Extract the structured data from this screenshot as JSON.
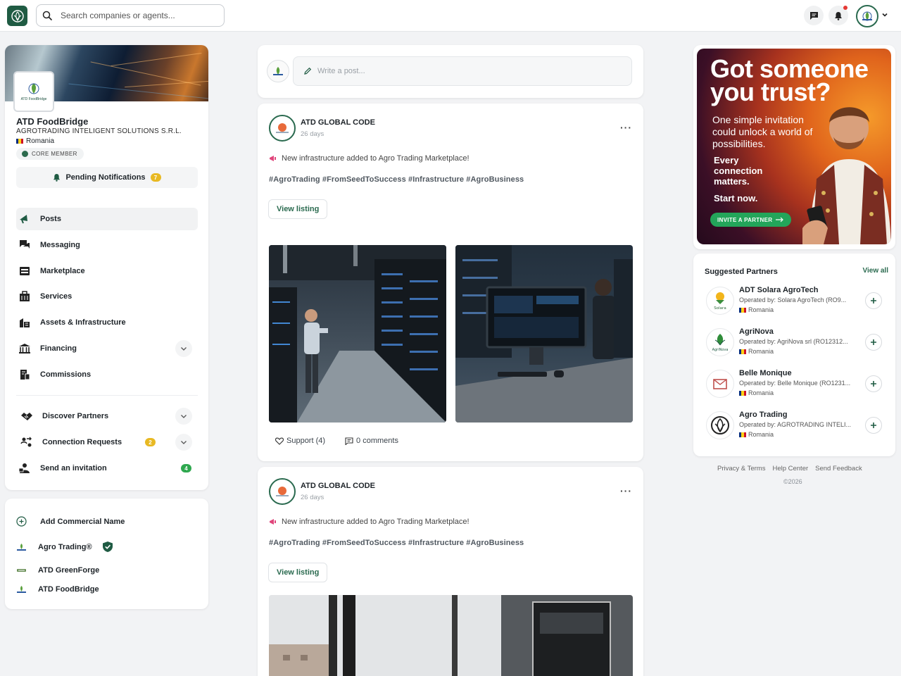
{
  "search": {
    "placeholder": "Search companies or agents..."
  },
  "profile": {
    "name": "ATD FoodBridge",
    "company": "AGROTRADING INTELIGENT SOLUTIONS S.R.L.",
    "country": "Romania",
    "badge": "CORE MEMBER",
    "logo_text": "ATD FoodBridge",
    "pending_label": "Pending Notifications",
    "pending_count": "7"
  },
  "nav": {
    "posts": "Posts",
    "messaging": "Messaging",
    "marketplace": "Marketplace",
    "services": "Services",
    "assets": "Assets & Infrastructure",
    "financing": "Financing",
    "commissions": "Commissions",
    "discover": "Discover Partners",
    "requests": "Connection Requests",
    "requests_count": "2",
    "invite": "Send an invitation",
    "invite_count": "4"
  },
  "commercial": {
    "add_label": "Add Commercial Name",
    "names": [
      "Agro Trading®",
      "ATD GreenForge",
      "ATD FoodBridge"
    ]
  },
  "composer": {
    "placeholder": "Write a post..."
  },
  "posts": [
    {
      "author": "ATD GLOBAL CODE",
      "time": "26 days",
      "text": "New infrastructure added to Agro Trading Marketplace!",
      "tags": "#AgroTrading #FromSeedToSuccess #Infrastructure #AgroBusiness",
      "button": "View listing",
      "support": "Support (4)",
      "comments": "0 comments"
    },
    {
      "author": "ATD GLOBAL CODE",
      "time": "26 days",
      "text": "New infrastructure added to Agro Trading Marketplace!",
      "tags": "#AgroTrading #FromSeedToSuccess #Infrastructure #AgroBusiness",
      "button": "View listing"
    }
  ],
  "ad": {
    "headline": "Got someone you trust?",
    "sub": "One simple invitation could unlock a world of possibilities.",
    "emphasis": "Every connection matters.",
    "cta_text": "Start now.",
    "button": "INVITE A PARTNER"
  },
  "suggested": {
    "title": "Suggested Partners",
    "view_all": "View all",
    "items": [
      {
        "name": "ADT Solara AgroTech",
        "operator": "Operated by: Solara AgroTech (RO9...",
        "country": "Romania",
        "logo_text": "Solara"
      },
      {
        "name": "AgriNova",
        "operator": "Operated by: AgriNova srl (RO12312...",
        "country": "Romania",
        "logo_text": "AgriNova"
      },
      {
        "name": "Belle Monique",
        "operator": "Operated by: Belle Monique (RO1231...",
        "country": "Romania",
        "logo_text": ""
      },
      {
        "name": "Agro Trading",
        "operator": "Operated by: AGROTRADING INTELI...",
        "country": "Romania",
        "logo_text": ""
      }
    ]
  },
  "footer": {
    "privacy": "Privacy & Terms",
    "help": "Help Center",
    "feedback": "Send Feedback",
    "copyright": "©2026"
  },
  "colors": {
    "brand_green": "#2a6a4f",
    "accent_green": "#23a55a",
    "badge_yellow": "#e8b923",
    "notif_red": "#e53935"
  },
  "icons": [
    "app-logo-icon",
    "search-icon",
    "message-icon",
    "bell-icon",
    "chevron-down-icon",
    "megaphone-icon",
    "pencil-icon",
    "heart-icon",
    "comment-icon",
    "plus-icon",
    "shield-check-icon"
  ]
}
